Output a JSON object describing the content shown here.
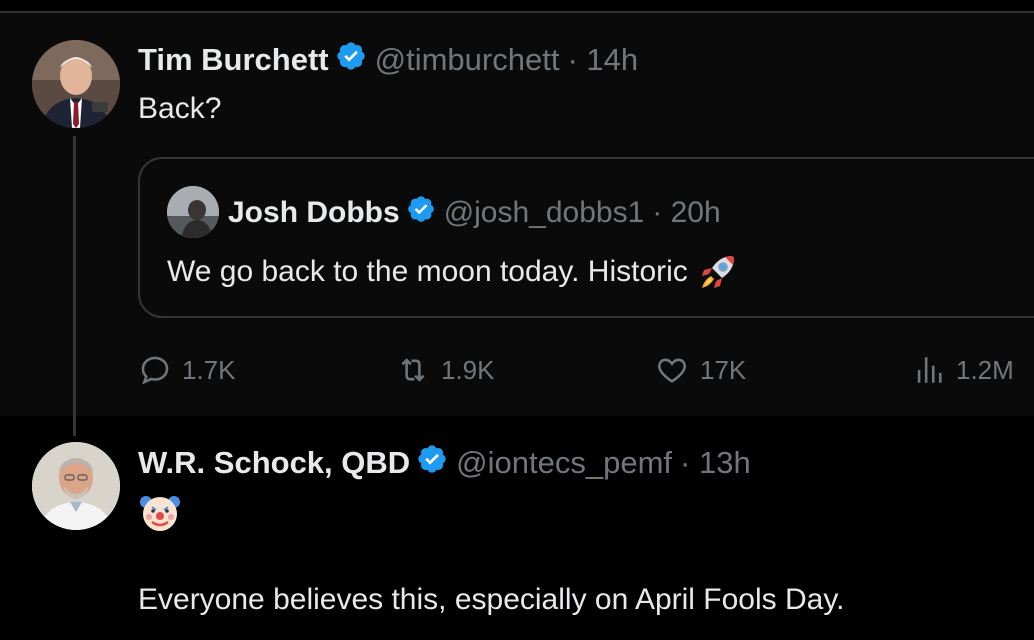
{
  "tweet": {
    "author_name": "Tim Burchett",
    "author_handle": "@timburchett",
    "time": "· 14h",
    "text": "Back?",
    "quoted": {
      "author_name": "Josh Dobbs",
      "author_handle": "@josh_dobbs1",
      "time": "· 20h",
      "text": "We go back to the moon today. Historic",
      "emoji_icon": "rocket-icon"
    },
    "stats": {
      "replies": "1.7K",
      "retweets": "1.9K",
      "likes": "17K",
      "views": "1.2M"
    }
  },
  "reply": {
    "author_name": "W.R. Schock, QBD",
    "author_handle": "@iontecs_pemf",
    "time": "· 13h",
    "emoji_icon": "clown-face-icon",
    "text": "Everyone believes this, especially on April Fools Day."
  },
  "colors": {
    "background": "#000000",
    "tweet_background": "#0a0a0a",
    "text": "#e7e9ea",
    "muted": "#71767b",
    "verified": "#1d9bf0",
    "border": "#333639"
  }
}
